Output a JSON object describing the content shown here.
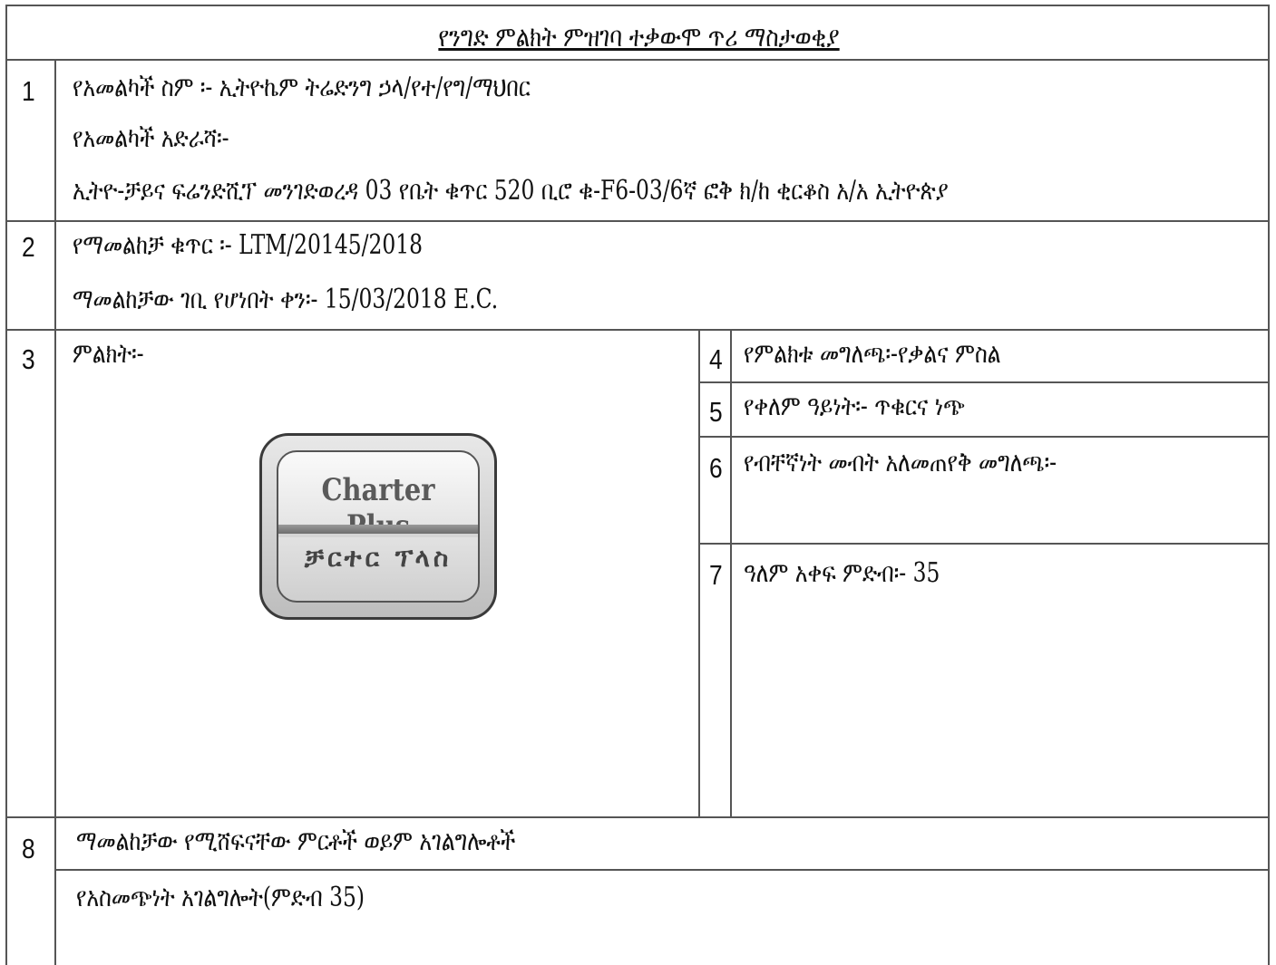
{
  "title": "የንግድ ምልክት ምዝገባ ተቃውሞ ጥሪ ማስታወቂያ",
  "section1": {
    "number": "1",
    "applicant_name": "የአመልካች ስም ፡- ኢትዮኬም ትሬድንግ ኃላ/የተ/የግ/ማህበር",
    "address_label": "የአመልካች አድራሻ፡-",
    "address": "ኢትዮ-ቻይና ፍሬንድሺፕ መንገድወረዳ 03 የቤት ቁጥር 520 ቢሮ ቁ-F6-03/6ኛ ፎቅ ክ/ከ ቂርቆስ አ/አ ኢትዮጵያ"
  },
  "section2": {
    "number": "2",
    "application_number": "የማመልከቻ ቁጥር ፡- LTM/20145/2018",
    "filing_date": "ማመልከቻው ገቢ የሆነበት ቀን፡- 15/03/2018 E.C."
  },
  "section3": {
    "number": "3",
    "label": "ምልክት፡-",
    "logo": {
      "text_en": "Charter Plus",
      "text_am": "ቻርተር ፕላስ"
    }
  },
  "section4": {
    "number": "4",
    "text": "የምልክቱ መግለጫ፡-የቃልና ምስል"
  },
  "section5": {
    "number": "5",
    "text": "የቀለም ዓይነት፡- ጥቁርና ነጭ"
  },
  "section6": {
    "number": "6",
    "text": "የብቸኛነት መብት አለመጠየቅ መግለጫ፡-"
  },
  "section7": {
    "number": "7",
    "text": "ዓለም አቀፍ ምድብ፡- 35"
  },
  "section8": {
    "number": "8",
    "heading": "ማመልከቻው የሚሸፍናቸው ምርቶች ወይም አገልግሎቶች",
    "services": "የአስመጭነት አገልግሎት(ምድብ 35)"
  }
}
